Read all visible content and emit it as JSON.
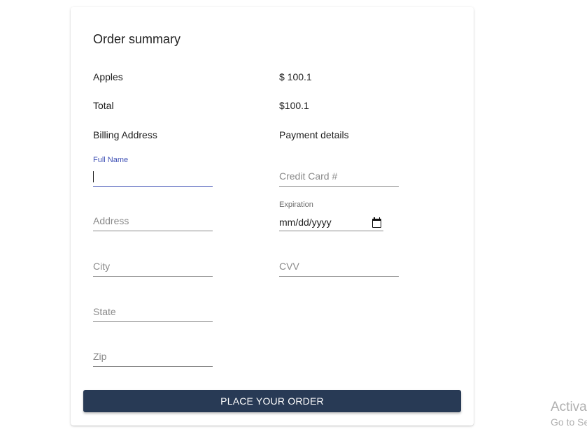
{
  "order_summary": {
    "title": "Order summary",
    "item_name": "Apples",
    "item_price": "$ 100.1",
    "total_label": "Total",
    "total_value": "$100.1"
  },
  "billing": {
    "heading": "Billing Address",
    "full_name_label": "Full Name",
    "full_name_value": "",
    "address_placeholder": "Address",
    "city_placeholder": "City",
    "state_placeholder": "State",
    "zip_placeholder": "Zip"
  },
  "payment": {
    "heading": "Payment details",
    "credit_card_placeholder": "Credit Card #",
    "expiration_label": "Expiration",
    "expiration_value": "mm/dd/yyyy",
    "cvv_placeholder": "CVV"
  },
  "actions": {
    "place_order_label": "PLACE YOUR ORDER"
  },
  "watermark": {
    "line1": "Activate Windows",
    "line2": "Go to Settings to activate Windows."
  },
  "colors": {
    "accent": "#3f51b5",
    "button_bg": "#283a55",
    "placeholder": "#8a8a8a"
  },
  "icons": {
    "expiration_picker": "calendar-icon"
  }
}
